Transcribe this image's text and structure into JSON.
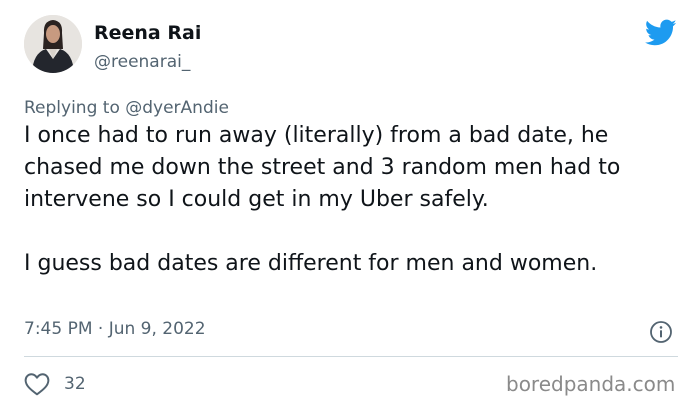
{
  "tweet": {
    "author_name": "Reena Rai",
    "author_handle": "@reenarai_",
    "reply_prefix": "Replying to ",
    "reply_target": "@dyerAndie",
    "paragraphs": [
      "I once had to run away (literally) from a bad date, he chased me down the street and 3 random men had to intervene so I could get in my Uber safely.",
      "I guess bad dates are different for men and women."
    ],
    "timestamp": "7:45 PM · Jun 9, 2022",
    "like_count": "32"
  },
  "icons": {
    "brand": "twitter-bird-icon",
    "info": "info-icon",
    "like": "heart-icon"
  },
  "colors": {
    "twitter_blue": "#1d9bf0",
    "muted_text": "#536471",
    "divider": "#cfd9de"
  },
  "watermark": "boredpanda.com"
}
